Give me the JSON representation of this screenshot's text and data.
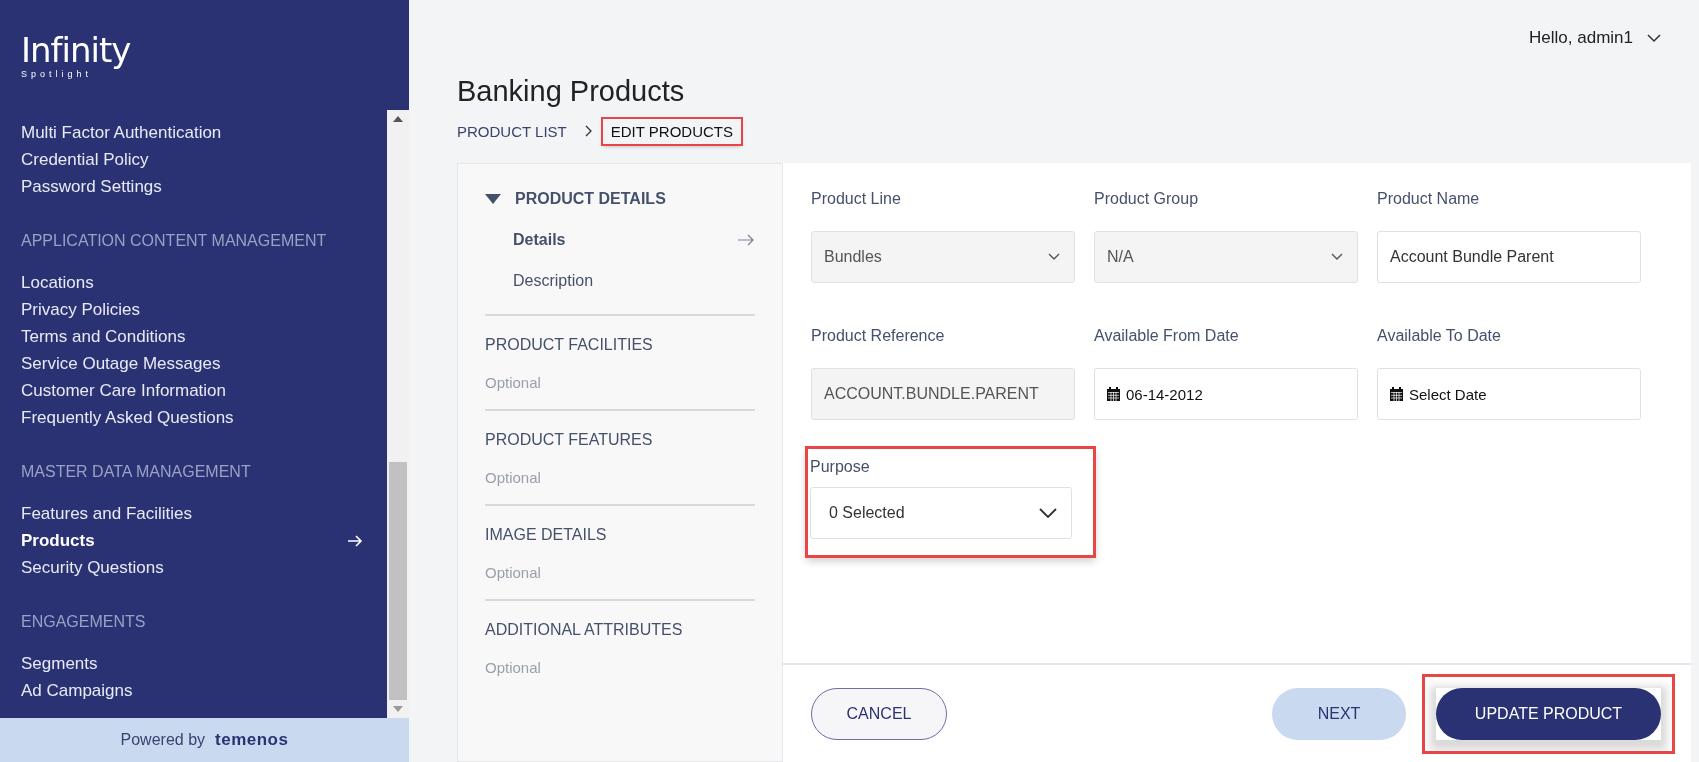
{
  "sidebar": {
    "logo": {
      "title": "Infinity",
      "subtitle": "Spotlight"
    },
    "sections": [
      {
        "items": [
          {
            "label": "Multi Factor Authentication",
            "selected": false
          },
          {
            "label": "Credential Policy",
            "selected": false
          },
          {
            "label": "Password Settings",
            "selected": false
          }
        ]
      },
      {
        "heading": "APPLICATION CONTENT MANAGEMENT",
        "items": [
          {
            "label": "Locations",
            "selected": false
          },
          {
            "label": "Privacy Policies",
            "selected": false
          },
          {
            "label": "Terms and Conditions",
            "selected": false
          },
          {
            "label": "Service Outage Messages",
            "selected": false
          },
          {
            "label": "Customer Care Information",
            "selected": false
          },
          {
            "label": "Frequently Asked Questions",
            "selected": false
          }
        ]
      },
      {
        "heading": "MASTER DATA MANAGEMENT",
        "items": [
          {
            "label": "Features and Facilities",
            "selected": false
          },
          {
            "label": "Products",
            "selected": true
          },
          {
            "label": "Security Questions",
            "selected": false
          }
        ]
      },
      {
        "heading": "ENGAGEMENTS",
        "items": [
          {
            "label": "Segments",
            "selected": false
          },
          {
            "label": "Ad Campaigns",
            "selected": false
          }
        ]
      }
    ],
    "footer": {
      "prefix": "Powered by",
      "brand": "temenos"
    }
  },
  "header": {
    "greeting": "Hello, admin1"
  },
  "page_title": "Banking Products",
  "breadcrumb": [
    {
      "label": "PRODUCT LIST",
      "highlighted": false
    },
    {
      "label": "EDIT PRODUCTS",
      "highlighted": true
    }
  ],
  "steps": [
    {
      "title": "PRODUCT DETAILS",
      "expanded": true,
      "children": [
        {
          "label": "Details",
          "selected": true
        },
        {
          "label": "Description",
          "selected": false
        }
      ]
    },
    {
      "title": "PRODUCT FACILITIES",
      "expanded": false,
      "subtitle": "Optional"
    },
    {
      "title": "PRODUCT FEATURES",
      "expanded": false,
      "subtitle": "Optional"
    },
    {
      "title": "IMAGE DETAILS",
      "expanded": false,
      "subtitle": "Optional"
    },
    {
      "title": "ADDITIONAL ATTRIBUTES",
      "expanded": false,
      "subtitle": "Optional"
    }
  ],
  "form": {
    "fields": [
      {
        "label": "Product Line",
        "kind": "select",
        "value": "Bundles",
        "disabled": true,
        "highlighted": false
      },
      {
        "label": "Product Group",
        "kind": "select",
        "value": "N/A",
        "disabled": true,
        "highlighted": false
      },
      {
        "label": "Product Name",
        "kind": "text",
        "value": "Account Bundle Parent",
        "disabled": false,
        "highlighted": false
      },
      {
        "label": "Product Reference",
        "kind": "text",
        "value": "ACCOUNT.BUNDLE.PARENT",
        "disabled": true,
        "highlighted": false
      },
      {
        "label": "Available From Date",
        "kind": "date",
        "value": "06-14-2012",
        "highlighted": false
      },
      {
        "label": "Available To Date",
        "kind": "date",
        "placeholder": "Select Date",
        "highlighted": false
      },
      {
        "label": "Purpose",
        "kind": "multiselect",
        "value": "0 Selected",
        "disabled": false,
        "highlighted": true
      }
    ]
  },
  "buttons": [
    {
      "label": "CANCEL",
      "kind": "outline",
      "highlighted": false
    },
    {
      "label": "NEXT",
      "kind": "light",
      "highlighted": false
    },
    {
      "label": "UPDATE PRODUCT",
      "kind": "primary",
      "highlighted": true
    }
  ]
}
